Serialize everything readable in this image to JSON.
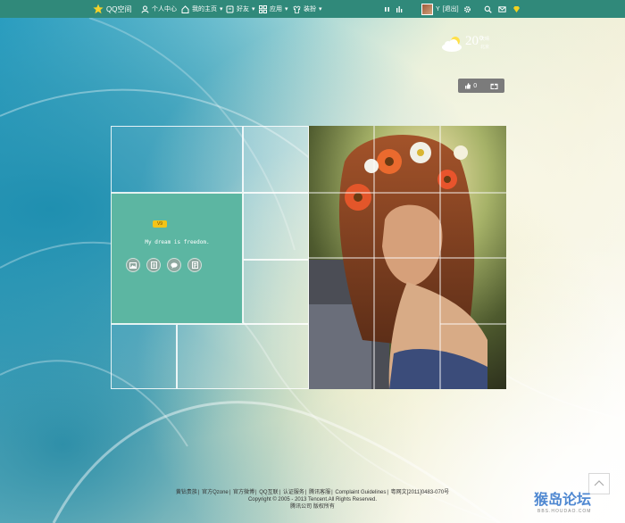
{
  "topbar": {
    "brand": "QQ空间",
    "nav": [
      {
        "label": "个人中心",
        "icon": "user-icon"
      },
      {
        "label": "我的主页",
        "icon": "home-icon"
      },
      {
        "label": "好友",
        "icon": "friends-icon"
      },
      {
        "label": "应用",
        "icon": "apps-icon"
      },
      {
        "label": "装扮",
        "icon": "shirt-icon"
      }
    ],
    "user": {
      "name": "Y",
      "logout": "[退出]"
    }
  },
  "weather": {
    "temp": "20°",
    "desc": "天晴",
    "city": "北京"
  },
  "like": {
    "count": "0"
  },
  "profile": {
    "badge": "V9",
    "motto": "My dream is freedom."
  },
  "footer": {
    "links": [
      "黄钻贵族",
      "官方Qzone",
      "官方微博",
      "QQ互联",
      "认证服务",
      "腾讯客服",
      "Complaint Guidelines",
      "粤网文[2011]0483-070号"
    ],
    "copyright": "Copyright © 2005 - 2013 Tencent.All Rights Reserved.",
    "company": "腾讯公司 版权所有"
  },
  "watermark": {
    "main": "猴岛论坛",
    "sub": "BBS.HOUDAO.COM"
  },
  "colors": {
    "topbar": "#30897a",
    "teal": "#5cb6a2"
  }
}
